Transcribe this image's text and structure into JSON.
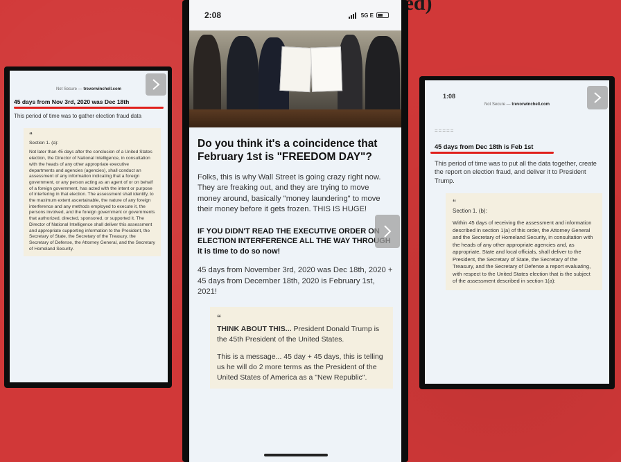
{
  "caption": "(Things Biden has ignored)",
  "left_phone": {
    "url_prefix": "Not Secure — ",
    "url_domain": "trevorwinchell.com",
    "headline": "45 days from Nov 3rd, 2020 was Dec 18th",
    "body": "This period of time was to gather election fraud data",
    "quote": {
      "mark": "“",
      "heading": "Section 1. (a):",
      "body": "Not later than 45 days after the conclusion of a United States election, the Director of National Intelligence, in consultation with the heads of any other appropriate executive departments and agencies (agencies), shall conduct an assessment of any information indicating that a foreign government, or any person acting as an agent of or on behalf of a foreign government, has acted with the intent or purpose of interfering in that election. The assessment shall identify, to the maximum extent ascertainable, the nature of any foreign interference and any methods employed to execute it, the persons involved, and the foreign government or governments that authorized, directed, sponsored, or supported it. The Director of National Intelligence shall deliver this assessment and appropriate supporting information to the President, the Secretary of State, the Secretary of the Treasury, the Secretary of Defense, the Attorney General, and the Secretary of Homeland Security."
    }
  },
  "center_phone": {
    "time": "2:08",
    "signal": "5G E",
    "headline": "Do you think it's a coincidence that February 1st is \"FREEDOM DAY\"?",
    "paragraph1": "Folks, this is why Wall Street is going crazy right now. They are freaking out, and they are trying to move money around, basically \"money laundering\" to move their money before it gets frozen. THIS IS HUGE!",
    "bold_notice": "IF YOU DIDN'T READ THE EXECUTIVE ORDER ON ELECTION INTERFERENCE ALL THE WAY THROUGH it is time to do so now!",
    "paragraph2": "45 days from November 3rd, 2020 was Dec 18th, 2020 + 45 days from December 18th, 2020 is February 1st, 2021!",
    "quote": {
      "mark": "“",
      "lead_bold": "THINK ABOUT THIS...",
      "lead_rest": " President Donald Trump is the 45th President of the United States.",
      "second": "This is a message... 45 day + 45 days, this is telling us he will do 2 more terms as the President of the United States of America as a \"New Republic\"."
    }
  },
  "right_phone": {
    "time": "1:08",
    "url_prefix": "Not Secure — ",
    "url_domain": "trevorwinchell.com",
    "divider": "=====",
    "headline": "45 days from Dec 18th is Feb 1st",
    "body": "This period of time was to put all the data together, create the report on election fraud, and deliver it to President Trump.",
    "quote": {
      "mark": "“",
      "heading": "Section 1. (b):",
      "body": "Within 45 days of receiving the assessment and information described in section 1(a) of this order, the Attorney General and the Secretary of Homeland Security, in consultation with the heads of any other appropriate agencies and, as appropriate, State and local officials, shall deliver to the President, the Secretary of State, the Secretary of the Treasury, and the Secretary of Defense a report evaluating, with respect to the United States election that is the subject of the assessment described in section 1(a):"
    }
  },
  "colors": {
    "background": "#d13838",
    "underline": "#e0201c",
    "quote_bg": "#f4efe0",
    "screen_bg": "#eef3f8"
  },
  "icons": {
    "next": "chevron-right-icon",
    "signal": "signal-bars-icon",
    "battery": "battery-icon",
    "wifi": "wifi-icon"
  }
}
